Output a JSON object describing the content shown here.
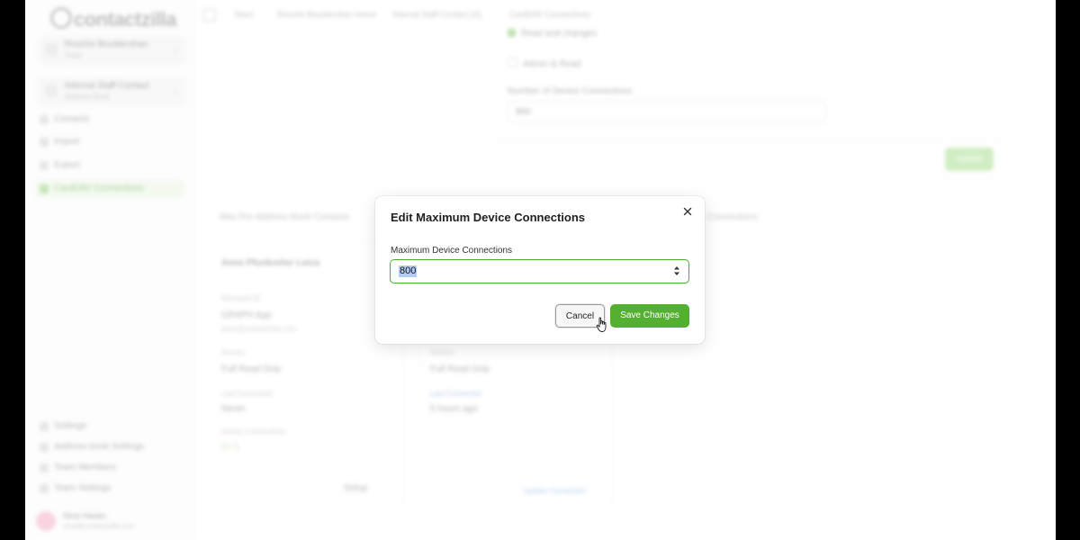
{
  "modal": {
    "title": "Edit Maximum Device Connections",
    "field_label": "Maximum Device Connections",
    "field_value": "800",
    "cancel_label": "Cancel",
    "save_label": "Save Changes",
    "accent_color": "#54b030",
    "close_icon": "close-icon",
    "spinner_icon": "up-down-stepper-icon"
  },
  "background": {
    "logo": "contactzilla",
    "workspace_1": {
      "title": "Rosche Bouldershan",
      "sub": "Team"
    },
    "workspace_2": {
      "title": "Internal Staff Contact",
      "sub": "Address Book"
    },
    "nav": [
      "Contacts",
      "Import",
      "Export",
      "CardDAV Connections"
    ],
    "active_nav": "CardDAV Connections",
    "settings_group": [
      "Settings",
      "Address book Settings",
      "Team Members",
      "Team Settings"
    ],
    "user": {
      "name": "Nina Hawks",
      "email": "nina@contactzilla.com"
    },
    "breadcrumbs": [
      "Team",
      "Rosche Bouldershan Home",
      "Internal Staff Contact (A)",
      "CardDAV Connections"
    ],
    "options": [
      "Read and changes",
      "Admin & Read"
    ],
    "max_connections_label": "Number of Device Connections",
    "max_connections_value": "800",
    "update_label": "Update",
    "tabs": [
      "Max Per Address Book Contacts",
      "Connections"
    ],
    "card_1": {
      "title": "Anne Pfunkreiter Leica",
      "id_label": "Managed ID",
      "id_value": "GRAPH App",
      "email": "anne@contactzilla.com",
      "access_label": "Access",
      "access_value": "Full Read Only",
      "last_label": "Last Connected",
      "last_value": "Never",
      "conn_label": "Device Connections",
      "conn_value": "0 / 1",
      "setup_label": "Setup"
    },
    "card_2": {
      "access_label": "Access",
      "access_value": "Full Read Only",
      "last_label": "Last Connected",
      "last_value": "5 hours ago",
      "link_label": "Update Connection"
    }
  }
}
